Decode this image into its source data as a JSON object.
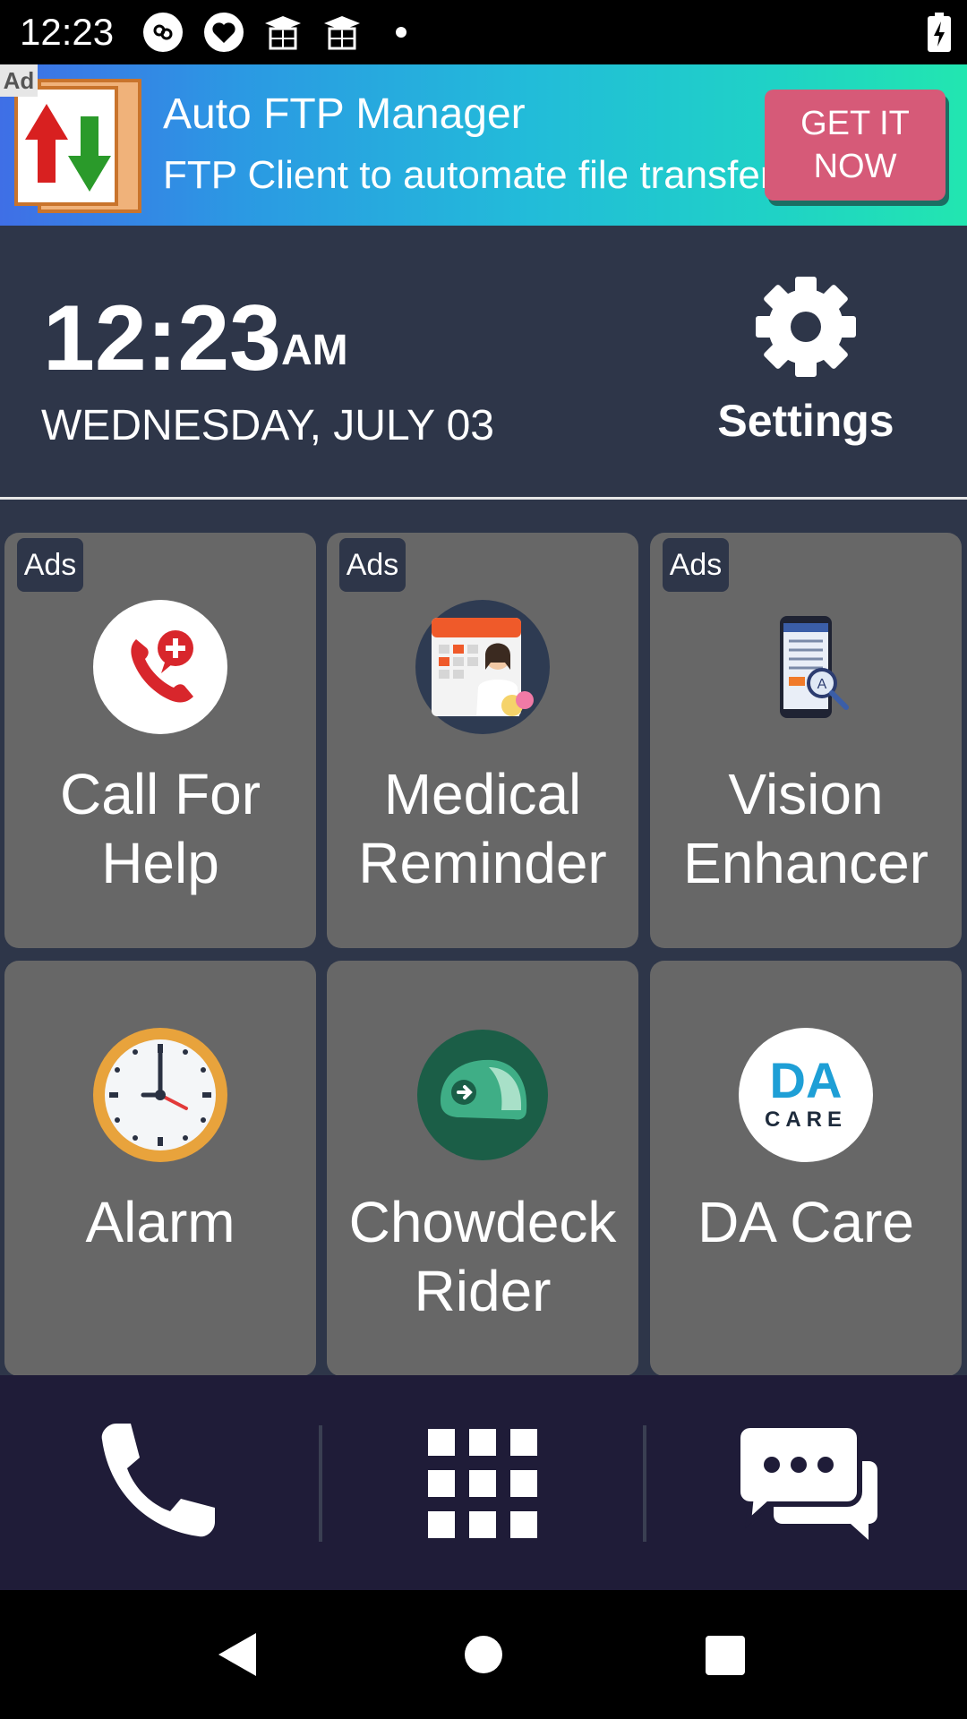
{
  "status_bar": {
    "time": "12:23",
    "icons": [
      "notification-app-icon",
      "heart-app-icon",
      "graduation-cap-icon",
      "graduation-cap-icon",
      "dot-icon",
      "battery-charging-icon"
    ]
  },
  "ad_banner": {
    "tag": "Ad",
    "title": "Auto FTP Manager",
    "subtitle": "FTP Client to automate file transfer",
    "cta_line1": "GET IT",
    "cta_line2": "NOW",
    "gradient_start": "#3f6fe6",
    "gradient_end": "#22e6b0",
    "cta_color": "#d65a78"
  },
  "clock": {
    "time": "12:23",
    "ampm": "AM",
    "date": "WEDNESDAY, JULY 03"
  },
  "settings": {
    "label": "Settings",
    "icon": "gear-icon"
  },
  "tiles": [
    {
      "label_line1": "Call For",
      "label_line2": "Help",
      "badge": "Ads",
      "icon": "call-for-help-icon"
    },
    {
      "label_line1": "Medical",
      "label_line2": "Reminder",
      "badge": "Ads",
      "icon": "medical-reminder-icon"
    },
    {
      "label_line1": "Vision",
      "label_line2": "Enhancer",
      "badge": "Ads",
      "icon": "vision-enhancer-icon"
    },
    {
      "label_line1": "Alarm",
      "label_line2": "",
      "badge": "",
      "icon": "alarm-clock-icon"
    },
    {
      "label_line1": "Chowdeck",
      "label_line2": "Rider",
      "badge": "",
      "icon": "chowdeck-helmet-icon"
    },
    {
      "label_line1": "DA Care",
      "label_line2": "",
      "badge": "",
      "icon": "da-care-logo-icon",
      "logo_text_top": "DA",
      "logo_text_bottom": "CARE"
    }
  ],
  "dock": {
    "items": [
      "phone-icon",
      "app-grid-icon",
      "messages-icon"
    ]
  },
  "nav_bar": {
    "items": [
      "back-icon",
      "home-icon",
      "recents-icon"
    ]
  },
  "colors": {
    "background": "#2e3649",
    "tile": "#676767",
    "dock": "#1f1c38",
    "alarm_rim": "#e8a33c",
    "chowdeck_green": "#1b5e47"
  }
}
